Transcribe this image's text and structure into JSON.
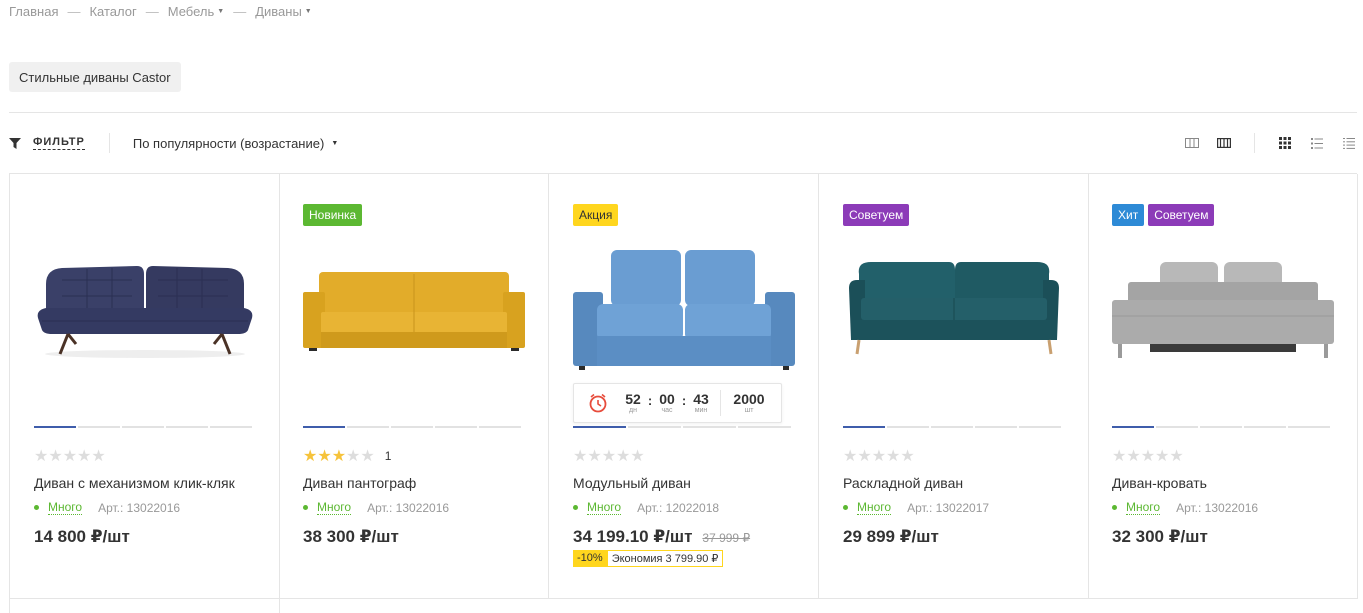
{
  "breadcrumb": {
    "items": [
      "Главная",
      "Каталог",
      "Мебель",
      "Диваны"
    ],
    "separator": "—"
  },
  "tag_chip": "Стильные диваны Castor",
  "toolbar": {
    "filter_label": "ФИЛЬТР",
    "sort_label": "По популярности (возрастание)"
  },
  "colors": {
    "new": "#5cb832",
    "sale": "#ffd61e",
    "recommend": "#8c3bb8",
    "hit": "#2d8ad6",
    "stock": "#5cb832",
    "image_dot_active": "#3f5dab"
  },
  "products": [
    {
      "title": "Диван с механизмом клик-кляк",
      "badges": [],
      "rating": 0,
      "reviews": "",
      "stock": "Много",
      "article": "Арт.: 13022016",
      "price": "14 800 ₽/шт",
      "old_price": "",
      "sofa_color": "#3a4068"
    },
    {
      "title": "Диван пантограф",
      "badges": [
        {
          "label": "Новинка",
          "type": "green"
        }
      ],
      "rating": 3,
      "reviews": "1",
      "stock": "Много",
      "article": "Арт.: 13022016",
      "price": "38 300 ₽/шт",
      "old_price": "",
      "sofa_color": "#e2ac2a"
    },
    {
      "title": "Модульный диван",
      "badges": [
        {
          "label": "Акция",
          "type": "yellow"
        }
      ],
      "rating": 0,
      "reviews": "",
      "stock": "Много",
      "article": "Арт.: 12022018",
      "price": "34 199.10 ₽/шт",
      "old_price": "37 999 ₽",
      "discount": "-10%",
      "savings": "Экономия 3 799.90 ₽",
      "timer": {
        "days": "52",
        "days_label": "дн",
        "hours": "00",
        "hours_label": "час",
        "minutes": "43",
        "minutes_label": "мин",
        "qty": "2000",
        "qty_label": "шт"
      },
      "sofa_color": "#5d91c8"
    },
    {
      "title": "Раскладной диван",
      "badges": [
        {
          "label": "Советуем",
          "type": "purple"
        }
      ],
      "rating": 0,
      "reviews": "",
      "stock": "Много",
      "article": "Арт.: 13022017",
      "price": "29 899 ₽/шт",
      "old_price": "",
      "sofa_color": "#1f5a63"
    },
    {
      "title": "Диван-кровать",
      "badges": [
        {
          "label": "Хит",
          "type": "blue"
        },
        {
          "label": "Советуем",
          "type": "purple"
        }
      ],
      "rating": 0,
      "reviews": "",
      "stock": "Много",
      "article": "Арт.: 13022016",
      "price": "32 300 ₽/шт",
      "old_price": "",
      "sofa_color": "#a8a8a8"
    }
  ]
}
